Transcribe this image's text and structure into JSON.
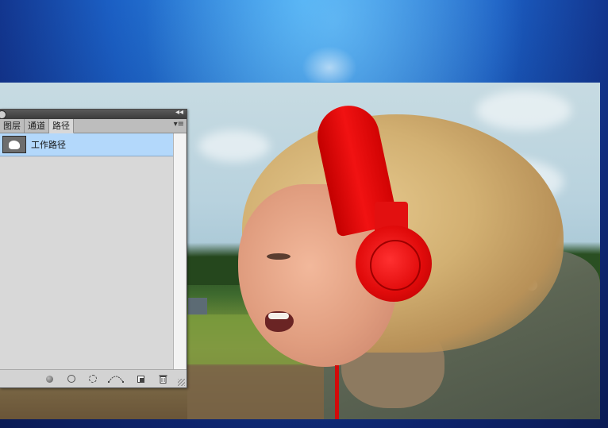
{
  "panel": {
    "tabs": [
      {
        "label": "图层",
        "active": false
      },
      {
        "label": "通道",
        "active": false
      },
      {
        "label": "路径",
        "active": true
      }
    ],
    "collapse_glyph": "◂◂",
    "menu_glyph": "▾≡",
    "paths": [
      {
        "name": "工作路径",
        "selected": true,
        "thumbnail_icon": "path-thumbnail-icon"
      }
    ],
    "footer_buttons": [
      {
        "name": "fill-path-button",
        "icon": "filled-circle-icon"
      },
      {
        "name": "stroke-path-button",
        "icon": "circle-outline-icon"
      },
      {
        "name": "load-as-selection-button",
        "icon": "dashed-circle-icon"
      },
      {
        "name": "make-work-path-button",
        "icon": "path-from-selection-icon"
      },
      {
        "name": "new-path-button",
        "icon": "new-page-icon"
      },
      {
        "name": "delete-path-button",
        "icon": "trash-icon"
      }
    ]
  },
  "colors": {
    "selection_row": "#b3d8fb",
    "headphones": "#e60f0f",
    "workspace": "#1b5fc4"
  }
}
